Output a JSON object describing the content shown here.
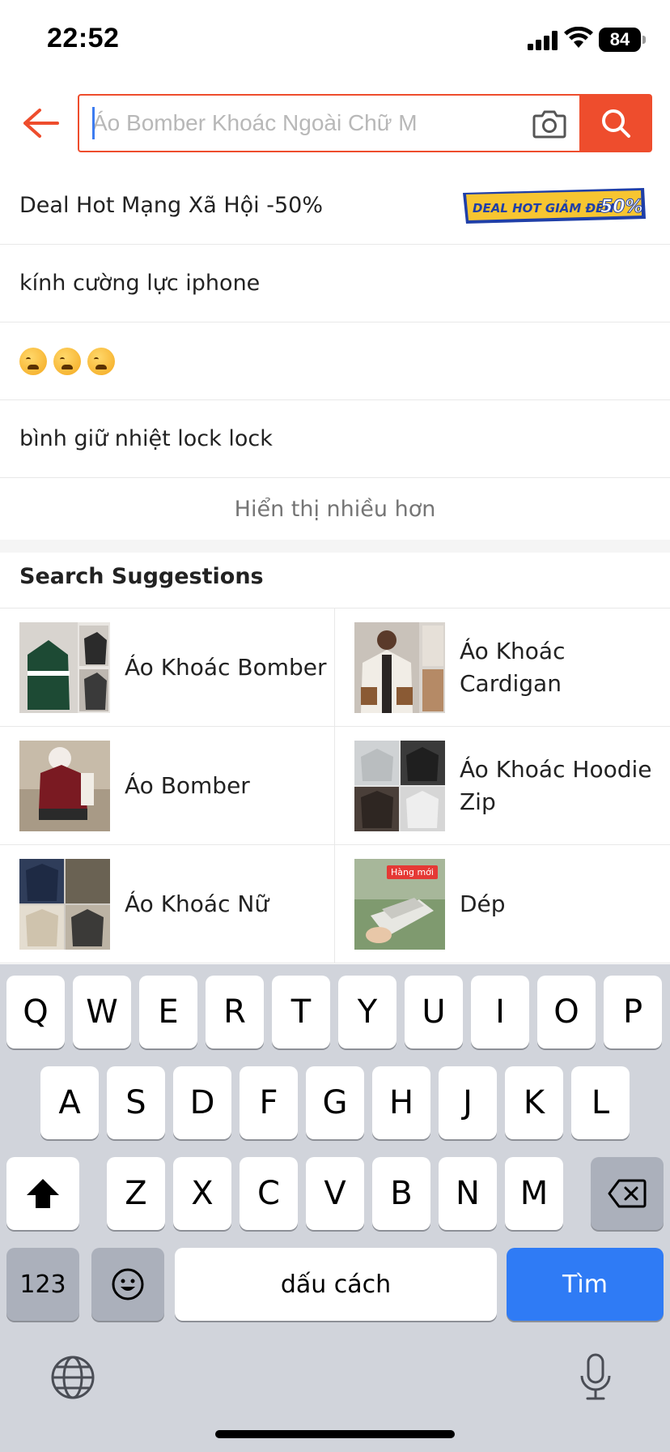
{
  "status_bar": {
    "time": "22:52",
    "battery": "84"
  },
  "search": {
    "placeholder": "Áo Bomber Khoác Ngoài Chữ M",
    "value": ""
  },
  "history": [
    {
      "text": "Deal Hot Mạng Xã Hội -50%",
      "badge": "DEAL HOT GIẢM ĐẾN 50%"
    },
    {
      "text": "kính cường lực iphone"
    },
    {
      "text": "😩😩😩"
    },
    {
      "text": "bình giữ nhiệt lock lock"
    }
  ],
  "show_more": "Hiển thị nhiều hơn",
  "suggestions": {
    "title": "Search Suggestions",
    "items": [
      {
        "label": "Áo Khoác Bomber"
      },
      {
        "label": "Áo Khoác Cardigan"
      },
      {
        "label": "Áo Bomber"
      },
      {
        "label": "Áo Khoác Hoodie Zip"
      },
      {
        "label": "Áo Khoác Nữ"
      },
      {
        "label": "Dép",
        "tag": "Hàng mới"
      }
    ]
  },
  "keyboard": {
    "row1": [
      "Q",
      "W",
      "E",
      "R",
      "T",
      "Y",
      "U",
      "I",
      "O",
      "P"
    ],
    "row2": [
      "A",
      "S",
      "D",
      "F",
      "G",
      "H",
      "J",
      "K",
      "L"
    ],
    "row3": [
      "Z",
      "X",
      "C",
      "V",
      "B",
      "N",
      "M"
    ],
    "numbers_key": "123",
    "space_key": "dấu cách",
    "return_key": "Tìm"
  },
  "colors": {
    "accent": "#ee4d2d",
    "keyboard_bg": "#d1d4db",
    "return_key": "#2f7bf5"
  }
}
